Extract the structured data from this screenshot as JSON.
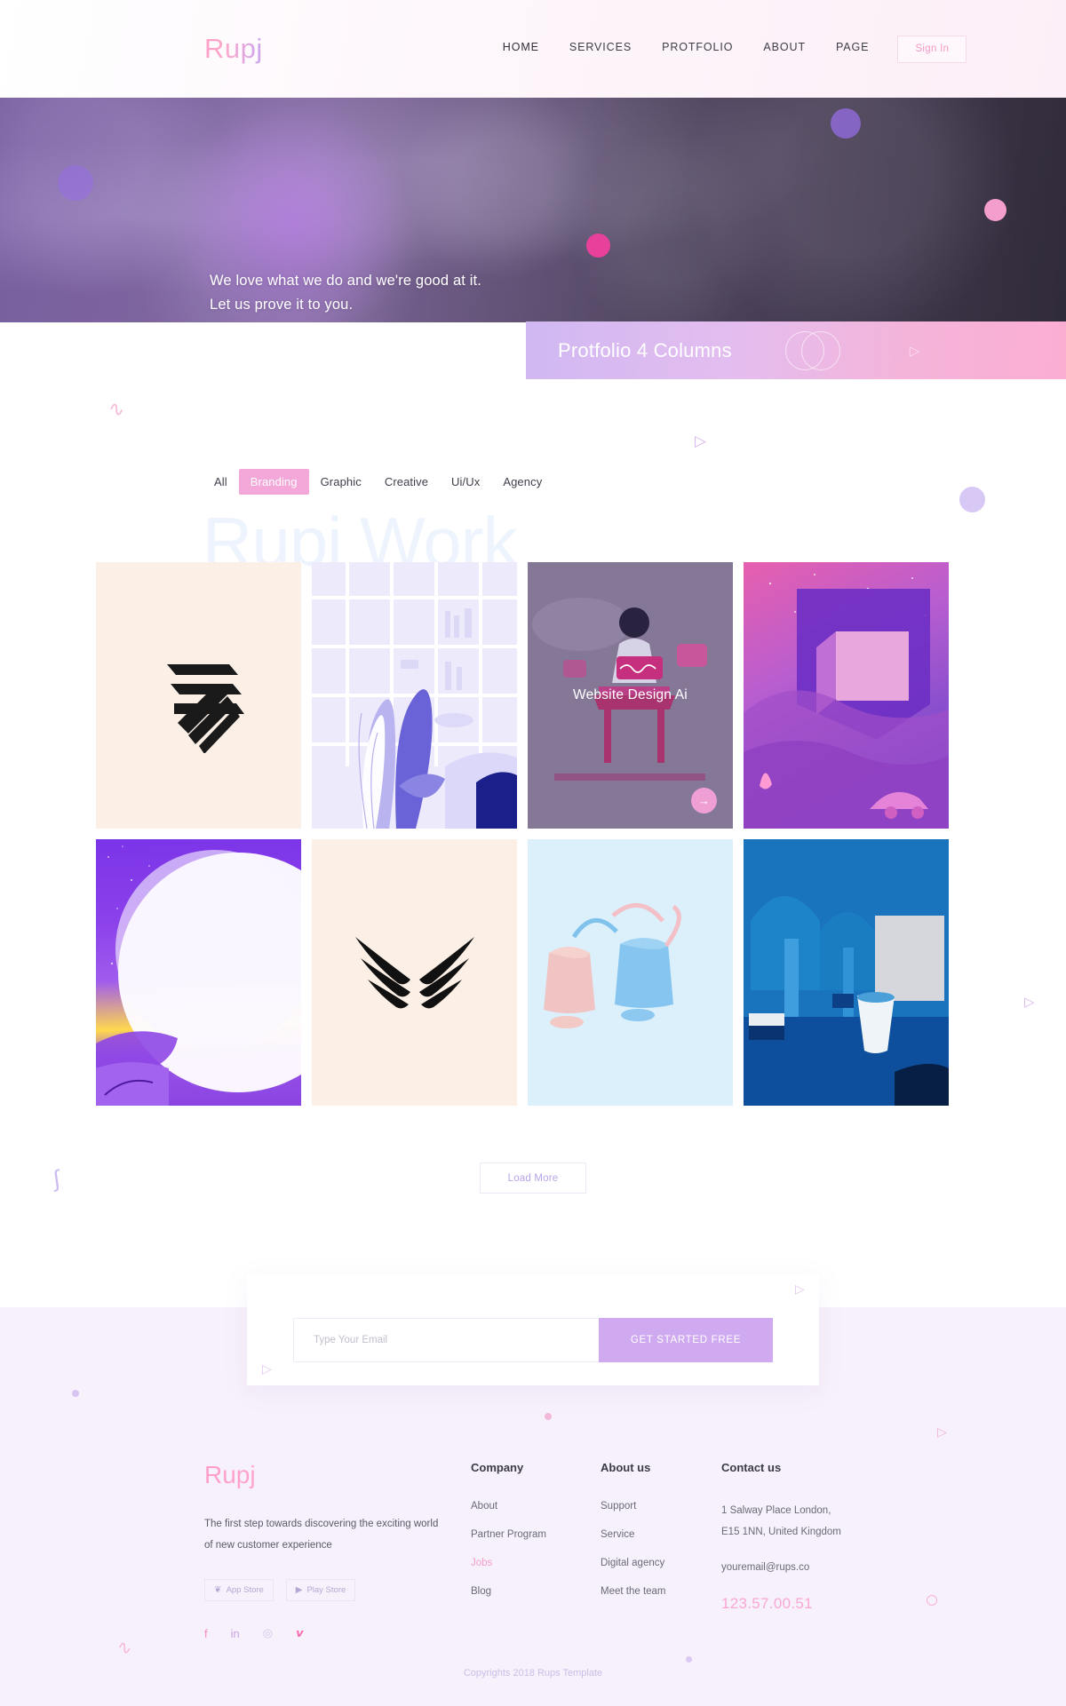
{
  "brand": {
    "name": "Rupj",
    "accent_pink": "#f3a8d9",
    "accent_purple": "#cfaaf0"
  },
  "header": {
    "logo": "Rupj",
    "nav": [
      {
        "label": "HOME",
        "active": true
      },
      {
        "label": "SERVICES",
        "active": false
      },
      {
        "label": "PROTFOLIO",
        "active": false
      },
      {
        "label": "ABOUT",
        "active": false
      },
      {
        "label": "PAGE",
        "active": false
      }
    ],
    "signin_label": "Sign In"
  },
  "hero": {
    "line1": "We love what we do and we're good at it.",
    "line2": "Let us prove it to you."
  },
  "banner": {
    "title": "Protfolio 4 Columns",
    "play_glyph": "▷"
  },
  "portfolio": {
    "watermark": "Rupj Work",
    "filters": [
      {
        "label": "All",
        "active": false
      },
      {
        "label": "Branding",
        "active": true
      },
      {
        "label": "Graphic",
        "active": false
      },
      {
        "label": "Creative",
        "active": false
      },
      {
        "label": "Ui/Ux",
        "active": false
      },
      {
        "label": "Agency",
        "active": false
      }
    ],
    "items": [
      {
        "art": "art-cream",
        "caption": "",
        "has_arrow": false
      },
      {
        "art": "art-office",
        "caption": "",
        "has_arrow": false
      },
      {
        "art": "art-desk",
        "caption": "Website Design Ai",
        "has_arrow": true
      },
      {
        "art": "art-night",
        "caption": "",
        "has_arrow": false
      },
      {
        "art": "art-moon",
        "caption": "",
        "has_arrow": false
      },
      {
        "art": "art-cream2",
        "caption": "",
        "has_arrow": false
      },
      {
        "art": "art-bags",
        "caption": "",
        "has_arrow": false
      },
      {
        "art": "art-blue",
        "caption": "",
        "has_arrow": false
      }
    ],
    "load_more_label": "Load More"
  },
  "signup": {
    "email_placeholder": "Type Your Email",
    "email_value": "",
    "button_label": "GET STARTED FREE"
  },
  "footer": {
    "logo": "Rupj",
    "description": "The first step towards discovering the exciting world of new customer experience",
    "stores": [
      {
        "label": "App Store",
        "icon": "apple-icon"
      },
      {
        "label": "Play Store",
        "icon": "play-icon"
      }
    ],
    "social": [
      {
        "name": "facebook-icon",
        "glyph": "f",
        "color": "#f08ec4"
      },
      {
        "name": "linkedin-icon",
        "glyph": "in",
        "color": "#c7a6e8"
      },
      {
        "name": "dribbble-icon",
        "glyph": "◎",
        "color": "#d3c3ea"
      },
      {
        "name": "vimeo-icon",
        "glyph": "𝙫",
        "color": "#f76bb0"
      }
    ],
    "columns": [
      {
        "heading": "Company",
        "links": [
          {
            "label": "About",
            "highlight": false
          },
          {
            "label": "Partner Program",
            "highlight": false
          },
          {
            "label": "Jobs",
            "highlight": true
          },
          {
            "label": "Blog",
            "highlight": false
          }
        ]
      },
      {
        "heading": "About us",
        "links": [
          {
            "label": "Support",
            "highlight": false
          },
          {
            "label": "Service",
            "highlight": false
          },
          {
            "label": "Digital agency",
            "highlight": false
          },
          {
            "label": "Meet the team",
            "highlight": false
          }
        ]
      }
    ],
    "contact": {
      "heading": "Contact us",
      "address_line1": "1 Salway Place London,",
      "address_line2": "E15 1NN, United Kingdom",
      "email": "youremail@rups.co",
      "phone": "123.57.00.51"
    },
    "copyright": "Copyrights 2018 Rups Template"
  }
}
